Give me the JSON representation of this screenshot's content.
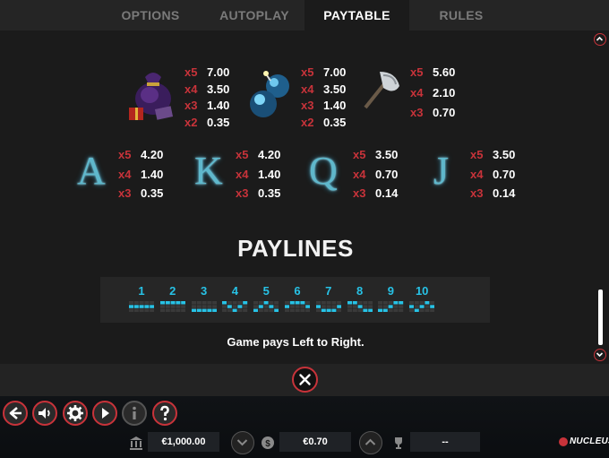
{
  "tabs": [
    {
      "label": "OPTIONS",
      "active": false
    },
    {
      "label": "AUTOPLAY",
      "active": false
    },
    {
      "label": "PAYTABLE",
      "active": true
    },
    {
      "label": "RULES",
      "active": false
    }
  ],
  "symbols_row1": [
    {
      "name": "bag-symbol",
      "pays": [
        [
          "x5",
          "7.00"
        ],
        [
          "x4",
          "3.50"
        ],
        [
          "x3",
          "1.40"
        ],
        [
          "x2",
          "0.35"
        ]
      ]
    },
    {
      "name": "bomb-symbol",
      "pays": [
        [
          "x5",
          "7.00"
        ],
        [
          "x4",
          "3.50"
        ],
        [
          "x3",
          "1.40"
        ],
        [
          "x2",
          "0.35"
        ]
      ]
    },
    {
      "name": "axe-symbol",
      "pays": [
        [
          "x5",
          "5.60"
        ],
        [
          "x4",
          "2.10"
        ],
        [
          "x3",
          "0.70"
        ]
      ]
    }
  ],
  "symbols_row2": [
    {
      "letter": "A",
      "pays": [
        [
          "x5",
          "4.20"
        ],
        [
          "x4",
          "1.40"
        ],
        [
          "x3",
          "0.35"
        ]
      ]
    },
    {
      "letter": "K",
      "pays": [
        [
          "x5",
          "4.20"
        ],
        [
          "x4",
          "1.40"
        ],
        [
          "x3",
          "0.35"
        ]
      ]
    },
    {
      "letter": "Q",
      "pays": [
        [
          "x5",
          "3.50"
        ],
        [
          "x4",
          "0.70"
        ],
        [
          "x3",
          "0.14"
        ]
      ]
    },
    {
      "letter": "J",
      "pays": [
        [
          "x5",
          "3.50"
        ],
        [
          "x4",
          "0.70"
        ],
        [
          "x3",
          "0.14"
        ]
      ]
    }
  ],
  "paylines": {
    "title": "PAYLINES",
    "numbers": [
      "1",
      "2",
      "3",
      "4",
      "5",
      "6",
      "7",
      "8",
      "9",
      "10"
    ],
    "rows": [
      [
        1,
        1,
        1,
        1,
        1
      ],
      [
        0,
        0,
        0,
        0,
        0
      ],
      [
        2,
        2,
        2,
        2,
        2
      ],
      [
        0,
        1,
        2,
        1,
        0
      ],
      [
        2,
        1,
        0,
        1,
        2
      ],
      [
        1,
        0,
        0,
        0,
        1
      ],
      [
        1,
        2,
        2,
        2,
        1
      ],
      [
        0,
        0,
        1,
        2,
        2
      ],
      [
        2,
        2,
        1,
        0,
        0
      ],
      [
        1,
        2,
        1,
        0,
        1
      ]
    ],
    "footnote": "Game pays Left to Right."
  },
  "controls": {
    "balance": "€1,000.00",
    "bet": "€0.70",
    "win": "--",
    "brand": "NUCLEUS"
  },
  "colors": {
    "accent": "#c8333a",
    "payline": "#27c2e6",
    "cell_off": "#3a3a3a"
  }
}
